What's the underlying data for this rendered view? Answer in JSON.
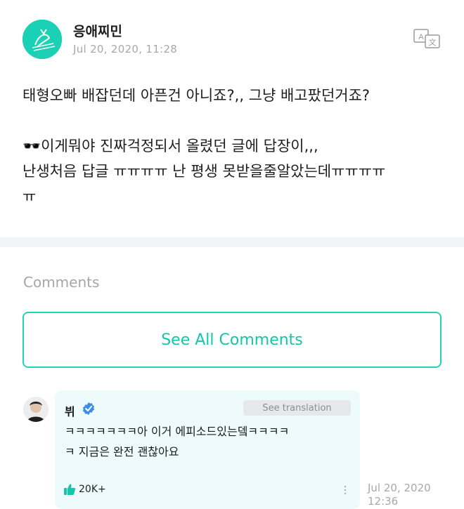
{
  "post": {
    "username": "응애찌민",
    "timestamp": "Jul 20, 2020, 11:28",
    "lines": [
      "태형오빠 배잡던데 아픈건 아니죠?,, 그냥 배고팠던거죠?",
      "",
      "🕶️이게뭐야 진짜걱정되서 올렸던 글에 답장이,,,",
      "난생처음 답글 ㅠㅠㅠㅠ 난 평생 못받을줄알았는데ㅠㅠㅠㅠ",
      "ㅠ"
    ]
  },
  "comments": {
    "label": "Comments",
    "see_all": "See All Comments",
    "items": [
      {
        "name": "뷔",
        "see_translation": "See translation",
        "lines": [
          "ㅋㅋㅋㅋㅋㅋㅋ아 이거 에피소드있는뎈ㅋㅋㅋㅋ",
          "ㅋ 지금은 완전 괜찮아요"
        ],
        "likes": "20K+",
        "time_line1": "Jul 20, 2020",
        "time_line2": "12:36"
      }
    ]
  },
  "colors": {
    "accent": "#13c6a9",
    "bubble": "#eefbfd",
    "muted": "#a8a8a8"
  },
  "icons": {
    "translate": "translate-icon",
    "verified": "verified-badge-icon",
    "like": "thumbs-up-icon",
    "more": "more-vertical-icon"
  }
}
